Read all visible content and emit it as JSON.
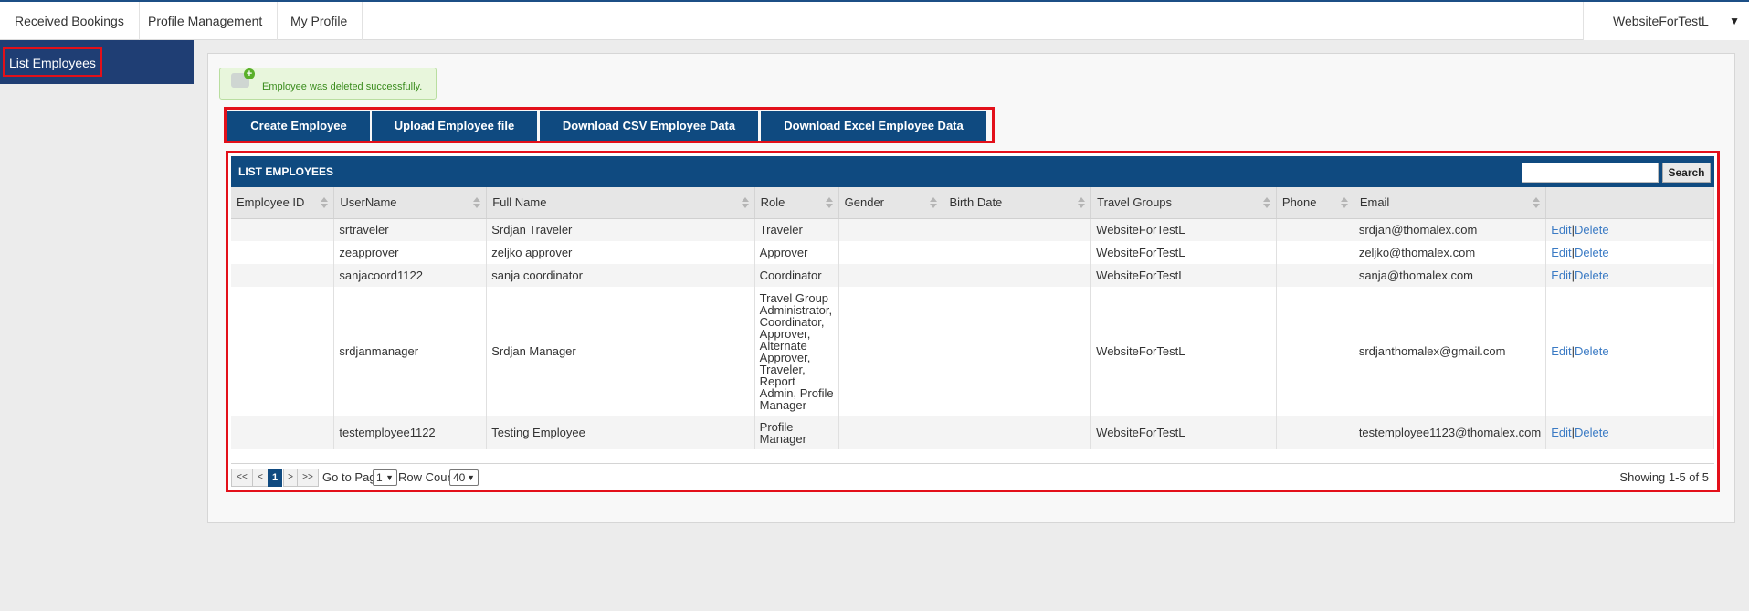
{
  "nav": {
    "tabs": [
      {
        "label": "Received Bookings"
      },
      {
        "label": "Profile Management"
      },
      {
        "label": "My Profile"
      }
    ],
    "site_select": "WebsiteForTestL"
  },
  "sidebar": {
    "items": [
      {
        "label": "List Employees"
      }
    ]
  },
  "alert": {
    "text": "Employee was deleted successfully."
  },
  "actions": {
    "create": "Create Employee",
    "upload": "Upload Employee file",
    "download_csv": "Download CSV Employee Data",
    "download_excel": "Download Excel Employee Data"
  },
  "grid": {
    "title": "LIST EMPLOYEES",
    "search_button": "Search",
    "search_value": "",
    "columns": [
      "Employee ID",
      "UserName",
      "Full Name",
      "Role",
      "Gender",
      "Birth Date",
      "Travel Groups",
      "Phone",
      "Email",
      ""
    ],
    "rows": [
      {
        "employee_id": "",
        "username": "srtraveler",
        "full_name": "Srdjan Traveler",
        "role": "Traveler",
        "gender": "",
        "birth_date": "",
        "travel_groups": "WebsiteForTestL",
        "phone": "",
        "email": "srdjan@thomalex.com",
        "edit": "Edit",
        "sep": "|",
        "delete": "Delete"
      },
      {
        "employee_id": "",
        "username": "zeapprover",
        "full_name": "zeljko approver",
        "role": "Approver",
        "gender": "",
        "birth_date": "",
        "travel_groups": "WebsiteForTestL",
        "phone": "",
        "email": "zeljko@thomalex.com",
        "edit": "Edit",
        "sep": "|",
        "delete": "Delete"
      },
      {
        "employee_id": "",
        "username": "sanjacoord1122",
        "full_name": "sanja coordinator",
        "role": "Coordinator",
        "gender": "",
        "birth_date": "",
        "travel_groups": "WebsiteForTestL",
        "phone": "",
        "email": "sanja@thomalex.com",
        "edit": "Edit",
        "sep": "|",
        "delete": "Delete"
      },
      {
        "employee_id": "",
        "username": "srdjanmanager",
        "full_name": "Srdjan Manager",
        "role": "Travel Group Administrator, Coordinator, Approver, Alternate Approver, Traveler, Report Admin, Profile Manager",
        "gender": "",
        "birth_date": "",
        "travel_groups": "WebsiteForTestL",
        "phone": "",
        "email": "srdjanthomalex@gmail.com",
        "edit": "Edit",
        "sep": "|",
        "delete": "Delete"
      },
      {
        "employee_id": "",
        "username": "testemployee1122",
        "full_name": "Testing Employee",
        "role": "Profile Manager",
        "gender": "",
        "birth_date": "",
        "travel_groups": "WebsiteForTestL",
        "phone": "",
        "email": "testemployee1123@thomalex.com",
        "edit": "Edit",
        "sep": "|",
        "delete": "Delete"
      }
    ]
  },
  "pager": {
    "first": "<<",
    "prev": "<",
    "current_page": "1",
    "next": ">",
    "last": ">>",
    "goto_label": "Go to Page:",
    "goto_value": "1",
    "rowcount_label": "Row Count:",
    "rowcount_value": "40",
    "showing": "Showing 1-5 of 5"
  },
  "colors": {
    "primary": "#0f4a80",
    "sidebar": "#1f3e74",
    "highlight": "#e3101a",
    "link": "#3a7ac4",
    "success": "#3a8c1d"
  }
}
